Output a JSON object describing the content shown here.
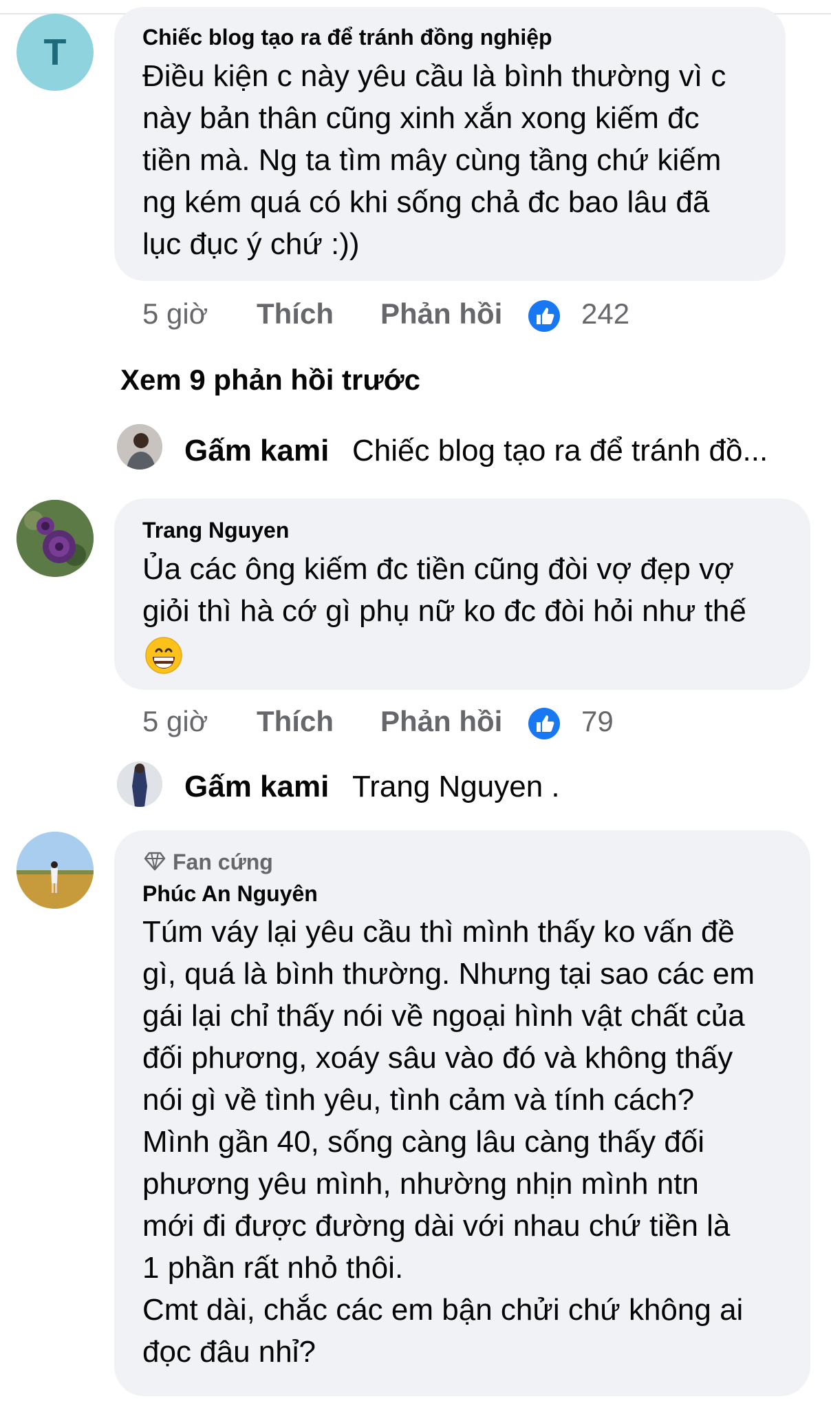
{
  "colors": {
    "accent": "#1877f2",
    "bubble": "#f0f2f5",
    "muted": "#65676b"
  },
  "comments": [
    {
      "avatar_letter": "T",
      "author": "Chiếc blog tạo ra để tránh đồng nghiệp",
      "lines": [
        "Điều kiện c này yêu cầu là bình thường vì c",
        "này bản thân cũng xinh xắn xong kiếm đc",
        "tiền mà. Ng ta tìm mây cùng tầng chứ kiếm",
        "ng kém quá có khi sống chả đc bao lâu đã",
        "lục đục ý chứ :))"
      ],
      "time": "5 giờ",
      "like_label": "Thích",
      "reply_label": "Phản hồi",
      "reaction_count": "242"
    },
    {
      "author": "Trang Nguyen",
      "lines": [
        "Ủa các ông kiếm đc tiền cũng đòi vợ đẹp vợ",
        "giỏi thì hà cớ gì phụ nữ ko đc đòi hỏi như thế"
      ],
      "emoji": "grinning-face",
      "time": "5 giờ",
      "like_label": "Thích",
      "reply_label": "Phản hồi",
      "reaction_count": "79"
    },
    {
      "badge": "Fan cứng",
      "author": "Phúc An Nguyên",
      "lines": [
        "Túm váy lại yêu cầu thì mình thấy ko vấn đề",
        "gì, quá là bình thường. Nhưng tại sao các em",
        "gái lại chỉ thấy nói về ngoại hình vật chất của",
        "đối phương, xoáy sâu vào đó và không thấy",
        "nói gì về tình yêu, tình cảm và tính cách?",
        "Mình gần 40, sống càng lâu càng thấy đối",
        "phương yêu mình, nhường nhịn mình ntn",
        "mới đi được đường dài với nhau chứ tiền là",
        "1 phần rất nhỏ thôi.",
        "Cmt dài, chắc các em bận chửi chứ không ai",
        "đọc đâu nhỉ?"
      ]
    }
  ],
  "view_previous_replies": "Xem 9 phản hồi trước",
  "replies": [
    {
      "name": "Gấm kami",
      "snippet": "Chiếc blog tạo ra để tránh đồ..."
    },
    {
      "name": "Gấm kami",
      "snippet": "Trang Nguyen ."
    }
  ]
}
